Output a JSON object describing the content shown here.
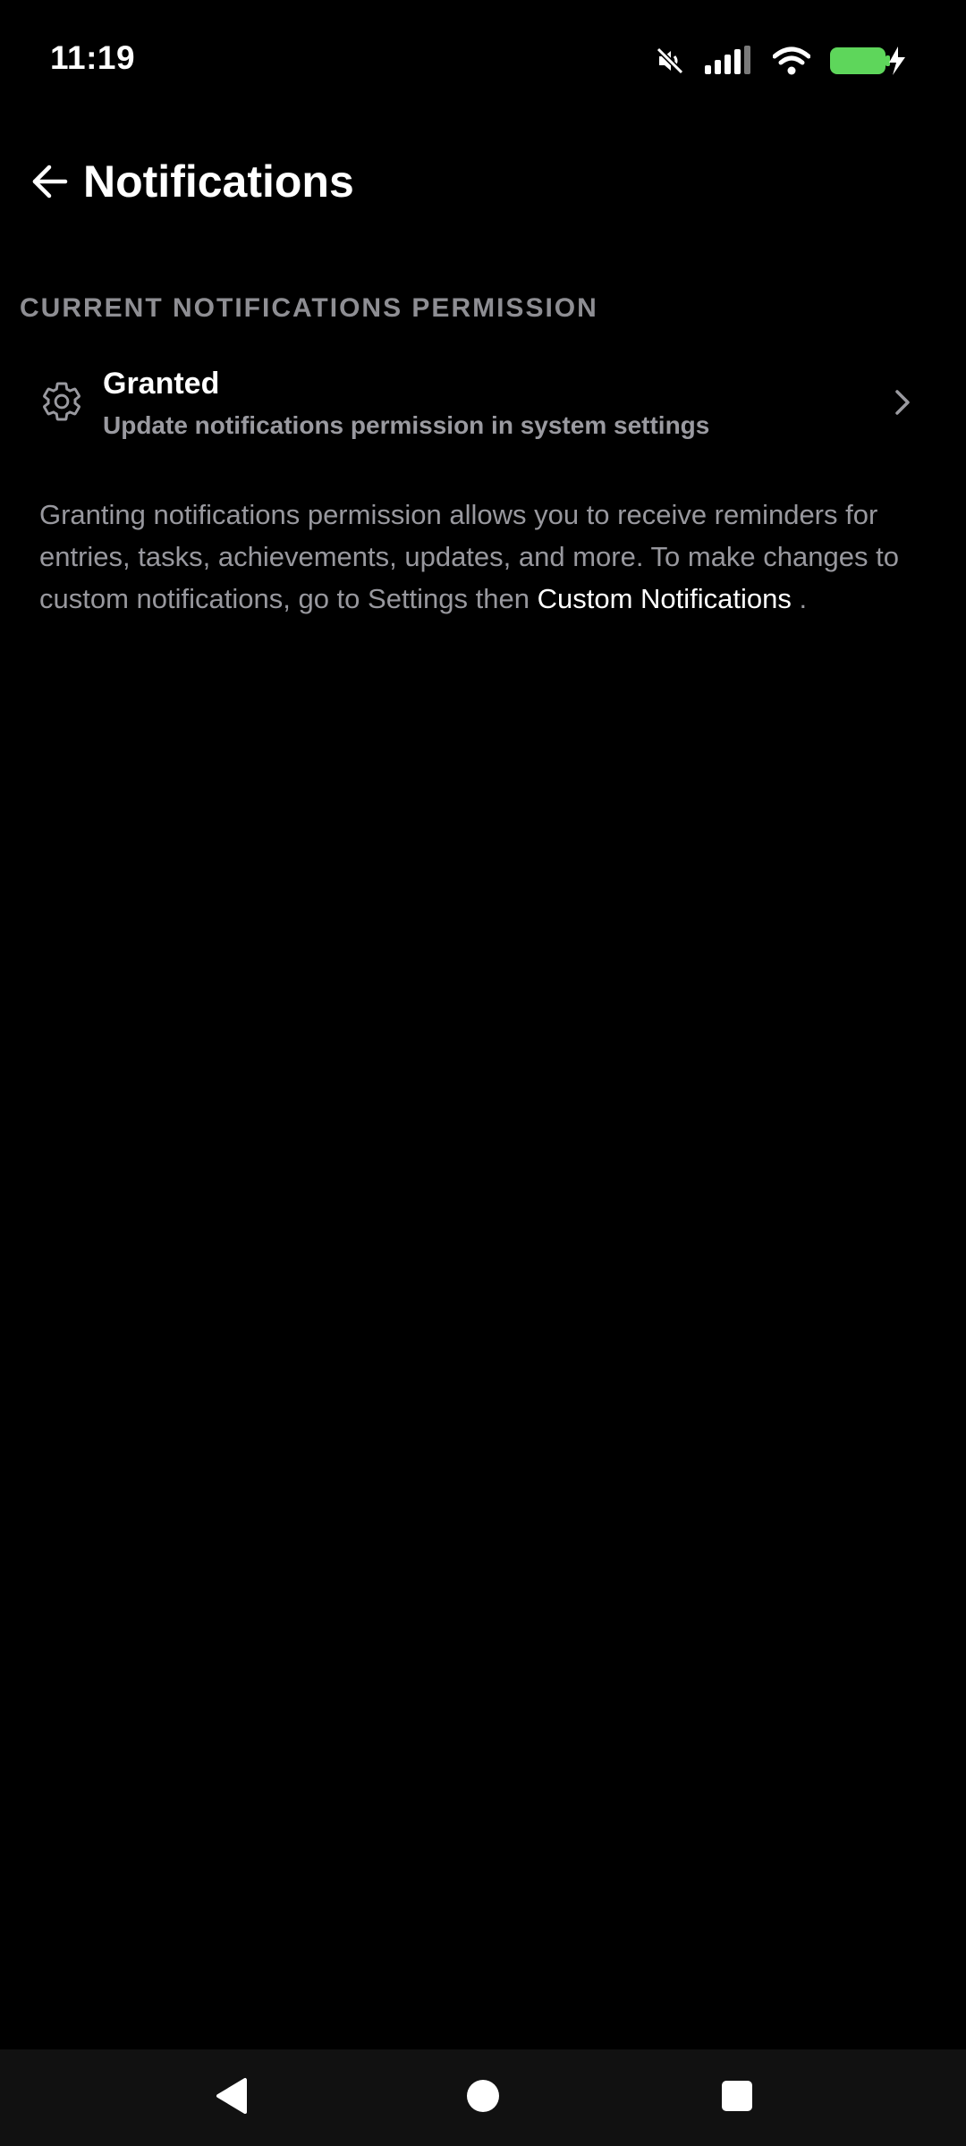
{
  "status_bar": {
    "time": "11:19",
    "icons": [
      "mute-icon",
      "signal-icon",
      "wifi-icon",
      "battery-charging-icon"
    ],
    "battery_color": "#5ed65b"
  },
  "app_bar": {
    "title": "Notifications",
    "back_icon": "arrow-left-icon"
  },
  "section": {
    "header": "CURRENT NOTIFICATIONS PERMISSION"
  },
  "permission": {
    "icon": "gear-icon",
    "title": "Granted",
    "subtitle": "Update notifications permission in system settings"
  },
  "description": {
    "text": "Granting notifications permission allows you to receive reminders for entries, tasks, achievements, updates, and more. To make changes to custom notifications, go to Settings then ",
    "link": "Custom Notifications",
    "suffix": " ."
  },
  "nav_bar": {
    "buttons": [
      "nav-back-icon",
      "nav-home-icon",
      "nav-recents-icon"
    ]
  }
}
